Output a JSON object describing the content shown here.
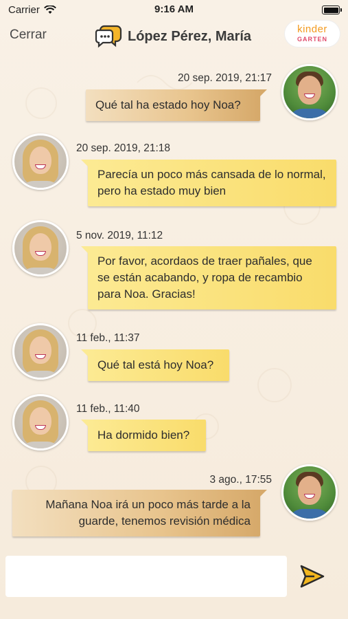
{
  "status_bar": {
    "carrier": "Carrier",
    "time": "9:16 AM"
  },
  "nav": {
    "close_label": "Cerrar",
    "title": "López Pérez, María",
    "logo_top": "kinder",
    "logo_bottom": "GARTEN"
  },
  "messages": [
    {
      "timestamp": "20 sep. 2019, 21:17",
      "text": "Qué tal ha estado hoy Noa?"
    },
    {
      "timestamp": "20 sep. 2019, 21:18",
      "text": "Parecía un poco más cansada de lo normal, pero ha estado muy bien"
    },
    {
      "timestamp": "5 nov. 2019, 11:12",
      "text": "Por favor, acordaos de traer pañales, que se están acabando, y ropa de recambio para Noa. Gracias!"
    },
    {
      "timestamp": "11 feb., 11:37",
      "text": "Qué tal está hoy Noa?"
    },
    {
      "timestamp": "11 feb., 11:40",
      "text": "Ha dormido bien?"
    },
    {
      "timestamp": "3 ago., 17:55",
      "text": "Mañana Noa irá un poco más tarde a la guarde, tenemos revisión médica"
    }
  ],
  "composer": {
    "placeholder": "",
    "value": ""
  },
  "colors": {
    "accent": "#e9a72a",
    "own_bubble": "#e8c48d",
    "other_bubble": "#f9dc6b",
    "background": "#f8efe3"
  },
  "icons": {
    "wifi": "wifi-icon",
    "battery": "battery-icon",
    "chat": "chat-bubble-icon",
    "send": "send-icon"
  }
}
